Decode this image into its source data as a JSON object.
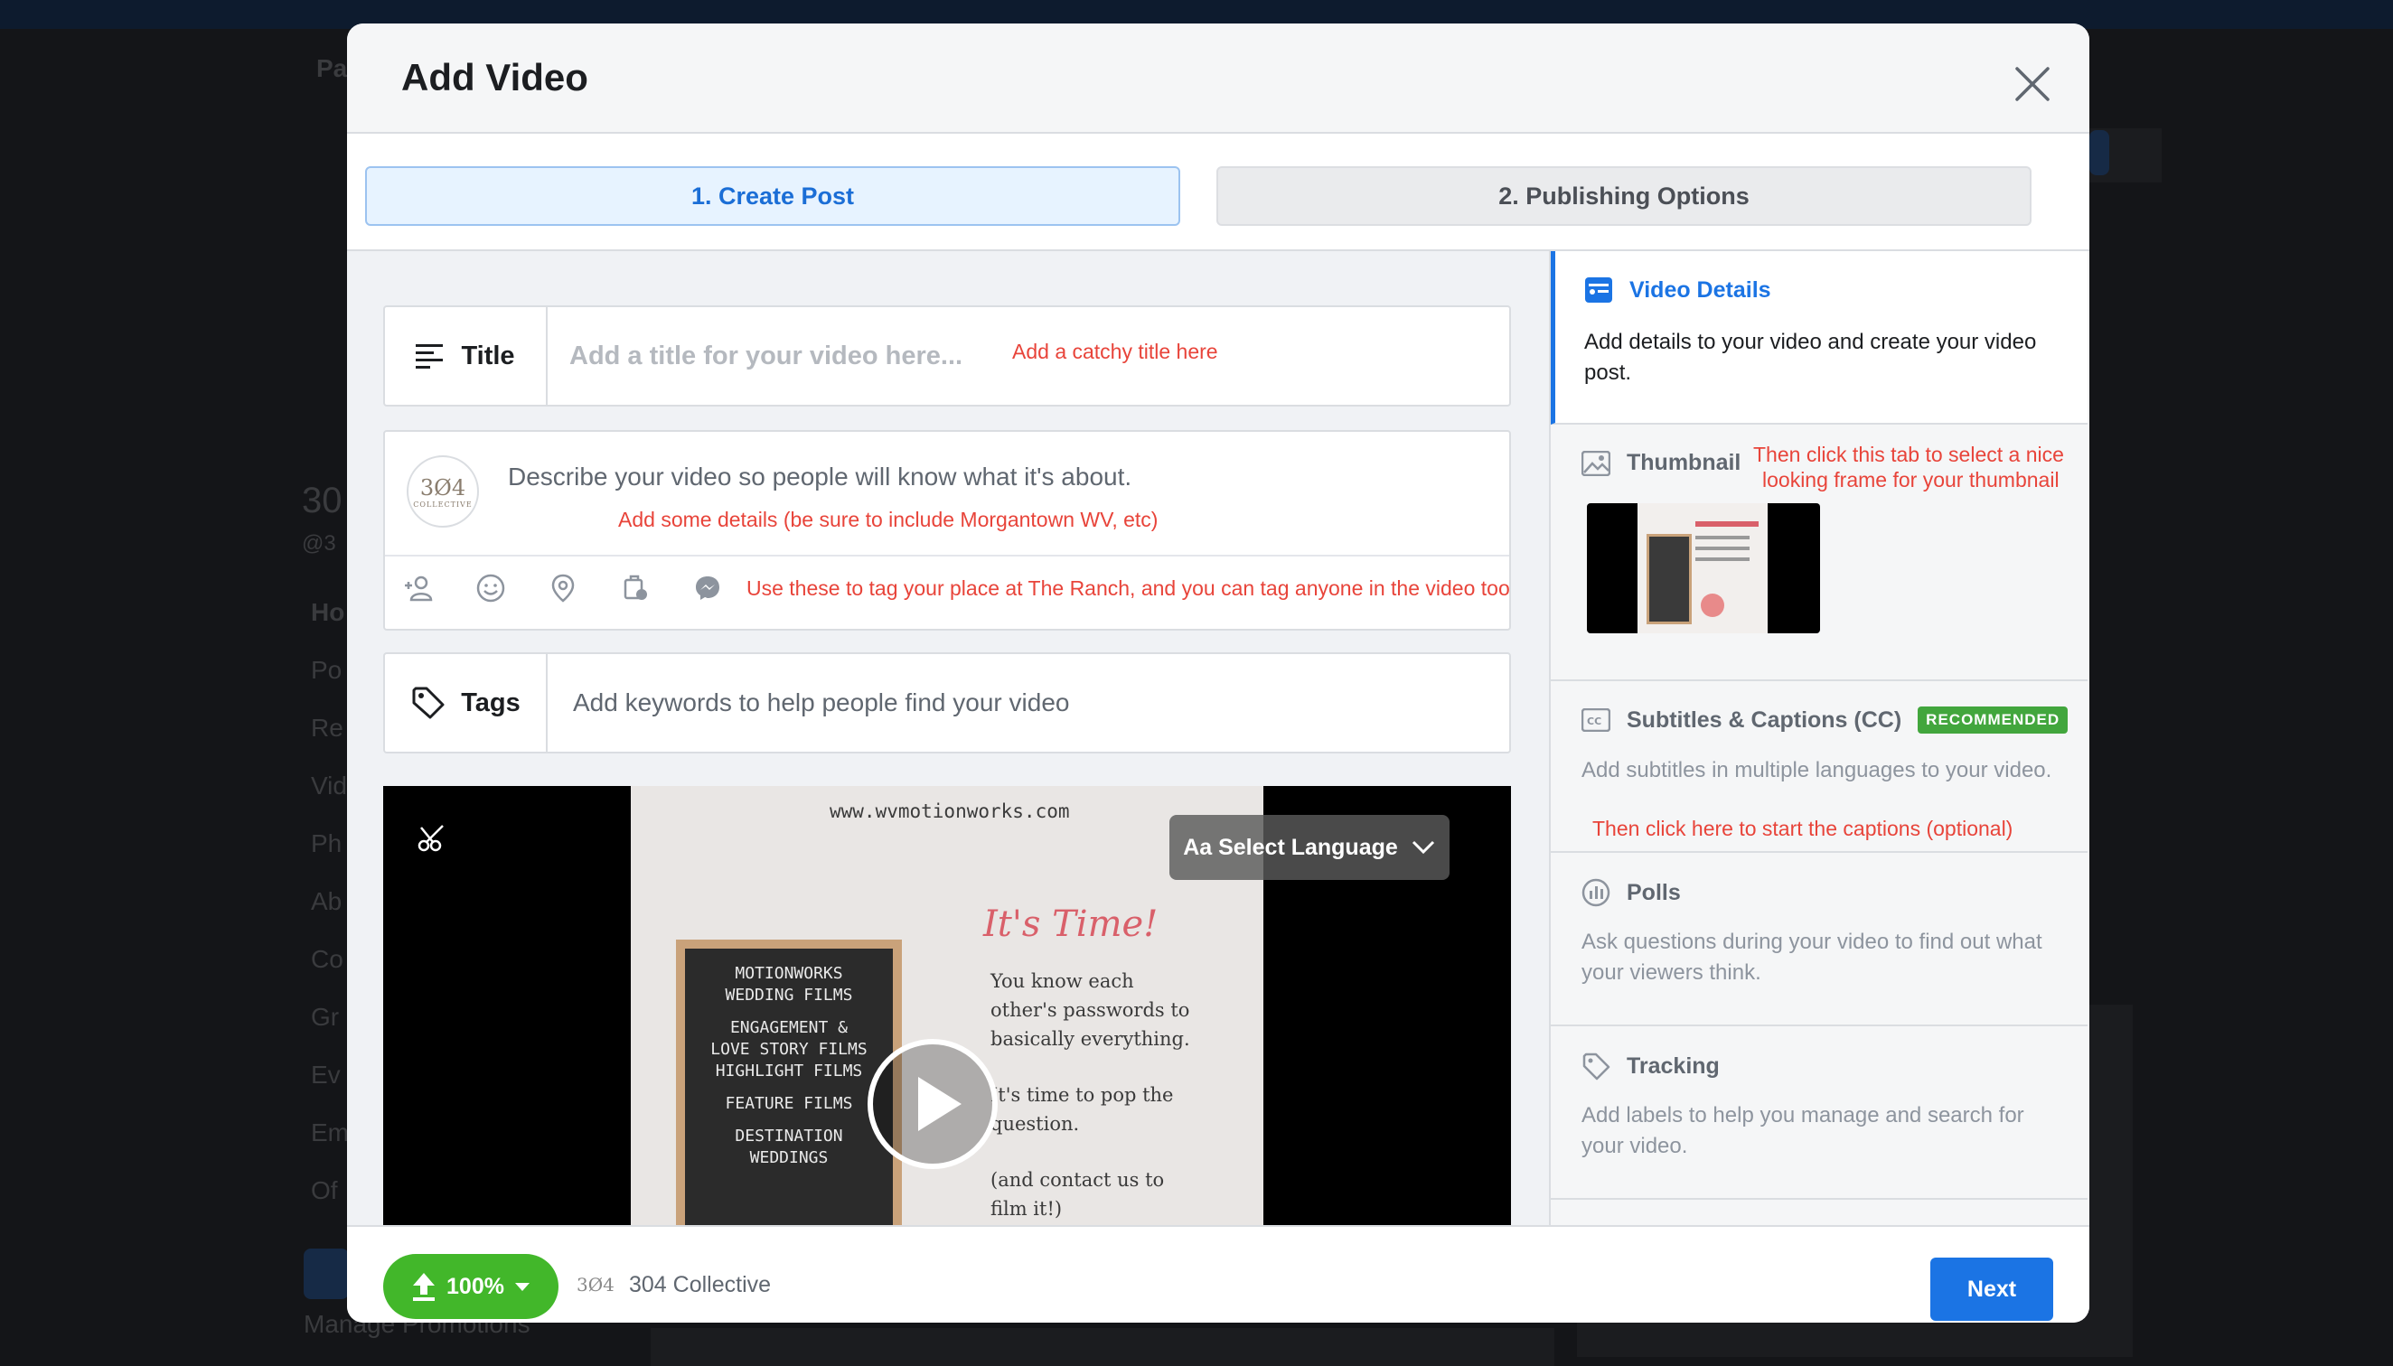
{
  "background": {
    "tab_label": "Pa",
    "page_name_partial": "30",
    "handle_partial": "@3",
    "nav_items": [
      "Ho",
      "Po",
      "Re",
      "Vid",
      "Ph",
      "Ab",
      "Co",
      "Gr",
      "Ev",
      "Em",
      "Of"
    ],
    "promo_label": "Manage Promotions"
  },
  "modal": {
    "title": "Add Video",
    "steps": [
      "1. Create Post",
      "2. Publishing Options"
    ],
    "title_field": {
      "label": "Title",
      "placeholder": "Add a title for your video here...",
      "annotation": "Add a catchy title here"
    },
    "description": {
      "avatar_text": "3Ø4",
      "avatar_sub": "COLLECTIVE",
      "placeholder": "Describe your video so people will know what it's about.",
      "annotation": "Add some details (be sure to include Morgantown WV, etc)",
      "tag_annotation": "Use these to tag your place at The Ranch, and you can tag anyone in the video too"
    },
    "tags_field": {
      "label": "Tags",
      "placeholder": "Add keywords to help people find your video"
    },
    "video": {
      "url": "www.wvmotionworks.com",
      "headline": "It's Time!",
      "body_lines": [
        "You know each",
        "other's passwords to",
        "basically everything.",
        "",
        "It's time to pop the",
        "question.",
        "",
        "(and contact us to",
        "film it!)"
      ],
      "letterboard_lines": [
        "MOTIONWORKS",
        "WEDDING FILMS",
        "",
        "ENGAGEMENT &",
        "LOVE STORY FILMS",
        "HIGHLIGHT FILMS",
        "",
        "FEATURE FILMS",
        "",
        "DESTINATION",
        "WEDDINGS"
      ],
      "language_button": "Aa Select Language"
    },
    "sidebar": {
      "video_details": {
        "title": "Video Details",
        "desc": "Add details to your video and create your video post."
      },
      "thumbnail": {
        "title": "Thumbnail",
        "annotation_line1": "Then click this tab to select a nice",
        "annotation_line2": "looking frame for your thumbnail"
      },
      "subtitles": {
        "title": "Subtitles & Captions (CC)",
        "badge": "RECOMMENDED",
        "desc": "Add subtitles in multiple languages to your video.",
        "annotation": "Then click here to start the captions (optional)"
      },
      "polls": {
        "title": "Polls",
        "desc": "Ask questions during your video to find out what your viewers think."
      },
      "tracking": {
        "title": "Tracking",
        "desc": "Add labels to help you manage and search for your video."
      }
    },
    "footer": {
      "upload_progress": "100%",
      "page_logo": "3Ø4",
      "page_name": "304 Collective",
      "next_label": "Next"
    }
  },
  "colors": {
    "accent": "#1b74e4",
    "annotation": "#e8443a",
    "success": "#42b72a"
  }
}
